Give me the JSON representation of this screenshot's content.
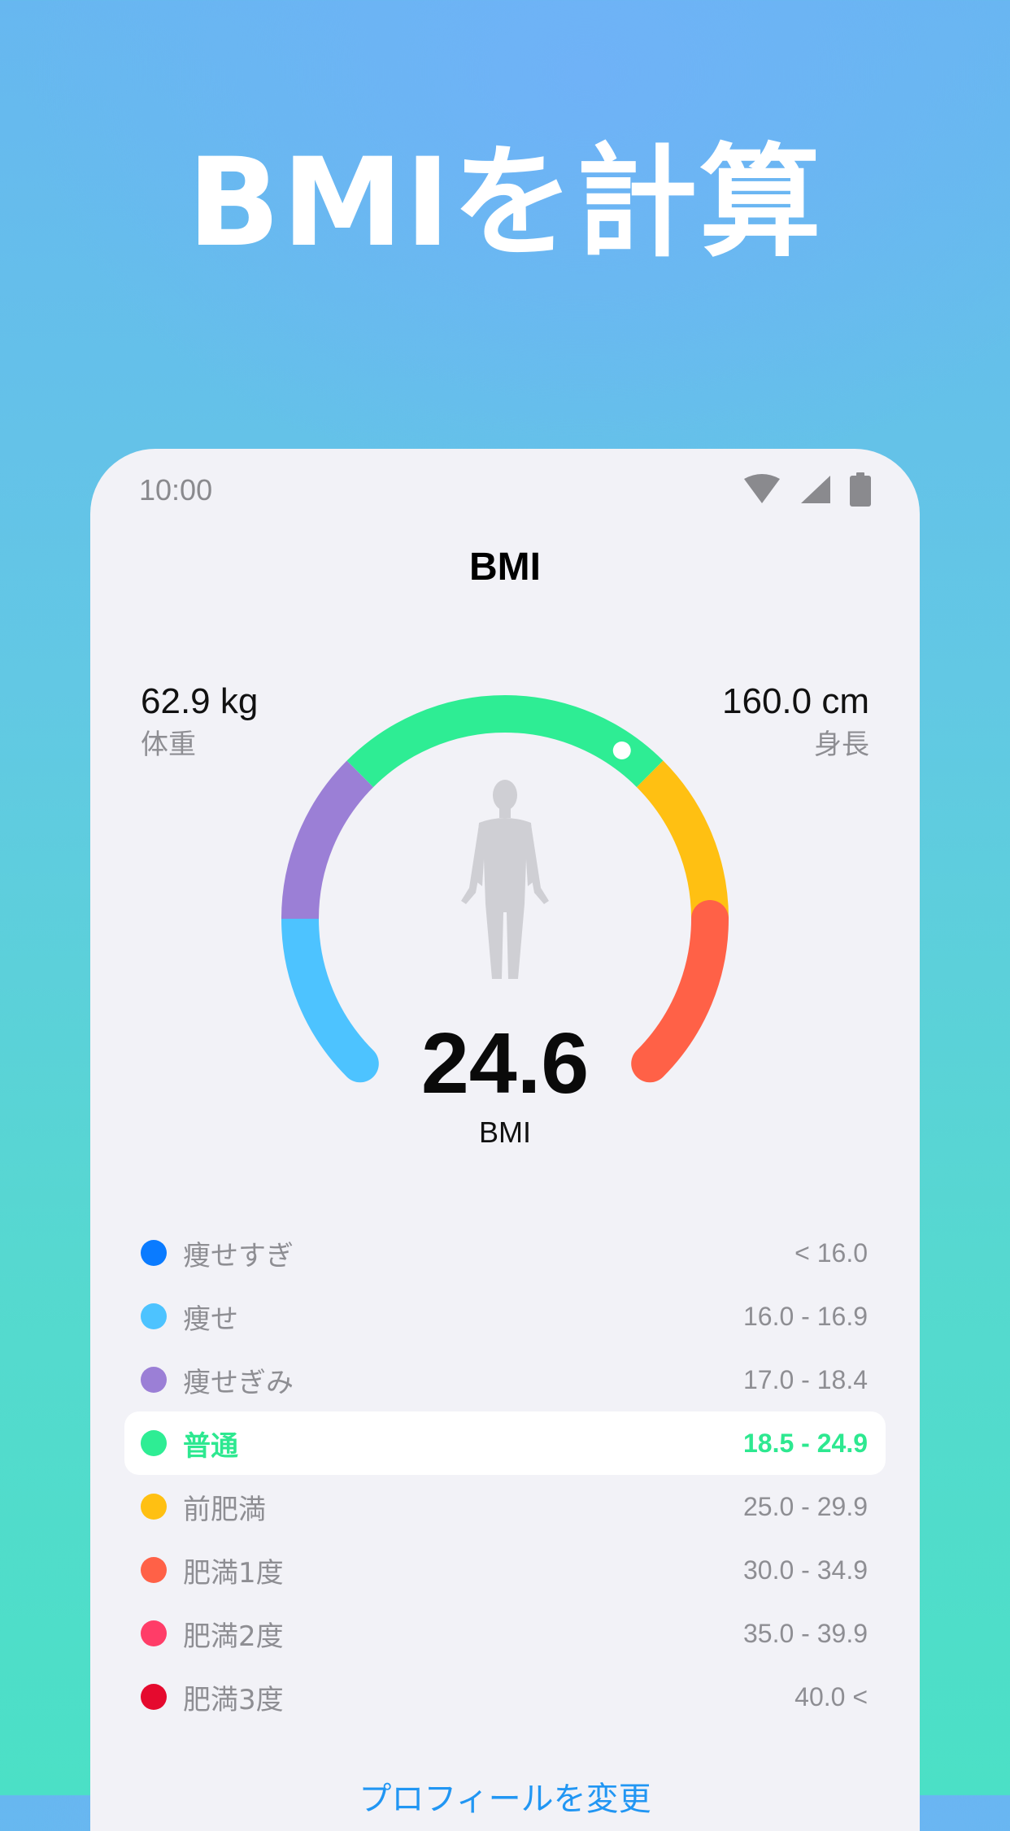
{
  "headline": "BMIを計算",
  "status_bar": {
    "time": "10:00",
    "icons": [
      "wifi-icon",
      "cellular-signal-icon",
      "battery-icon"
    ]
  },
  "screen": {
    "title": "BMI",
    "weight": {
      "value": "62.9 kg",
      "label": "体重"
    },
    "height": {
      "value": "160.0 cm",
      "label": "身長"
    },
    "bmi": {
      "value": "24.6",
      "label": "BMI"
    },
    "gauge": {
      "indicator_value": 24.6,
      "segment_colors": [
        "#4dc3ff",
        "#9b7fd6",
        "#2eed94",
        "#ffc012",
        "#ff6147"
      ],
      "figure_icon": "human-silhouette-icon"
    },
    "legend": [
      {
        "name": "痩せすぎ",
        "range": "< 16.0",
        "color": "#0a7bff"
      },
      {
        "name": "痩せ",
        "range": "16.0 - 16.9",
        "color": "#4dc3ff"
      },
      {
        "name": "痩せぎみ",
        "range": "17.0 - 18.4",
        "color": "#9b7fd6"
      },
      {
        "name": "普通",
        "range": "18.5 - 24.9",
        "color": "#2eed94",
        "active": true
      },
      {
        "name": "前肥満",
        "range": "25.0 - 29.9",
        "color": "#ffc012"
      },
      {
        "name": "肥満1度",
        "range": "30.0 - 34.9",
        "color": "#ff6147"
      },
      {
        "name": "肥満2度",
        "range": "35.0 - 39.9",
        "color": "#ff3d68"
      },
      {
        "name": "肥満3度",
        "range": "40.0 <",
        "color": "#e50a2e"
      }
    ],
    "bottom_link": "プロフィールを変更"
  }
}
